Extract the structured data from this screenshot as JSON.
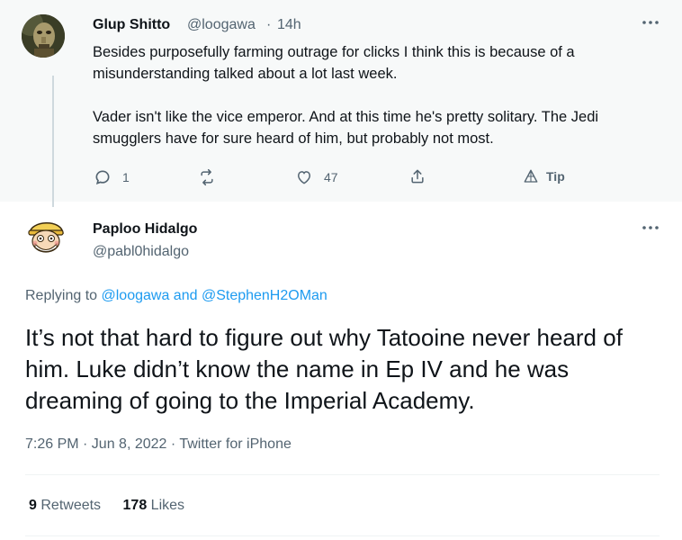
{
  "parent_tweet": {
    "author_name": "Glup Shitto",
    "author_handle": "@loogawa",
    "separator": "·",
    "time_ago": "14h",
    "more_icon": "more-icon",
    "paragraph1": "Besides purposefully farming outrage for clicks I think this is because of a misunderstanding talked about a lot last week.",
    "paragraph2": "Vader isn't like the vice emperor. And at this time he's pretty solitary. The Jedi smugglers have for sure heard of him, but probably not most.",
    "actions": {
      "reply_count": "1",
      "retweet_count": "",
      "like_count": "47",
      "tip_label": "Tip"
    }
  },
  "main_tweet": {
    "author_name": "Paploo Hidalgo",
    "author_handle": "@pabl0hidalgo",
    "replying_prefix": "Replying to",
    "replying_user1": "@loogawa",
    "replying_and": "and",
    "replying_user2": "@StephenH2OMan",
    "text": "It’s not that hard to figure out why Tatooine never heard of him. Luke didn’t know the name in Ep IV and he was dreaming of going to the Imperial Academy.",
    "timestamp": "7:26 PM · Jun 8, 2022 · Twitter for iPhone",
    "retweets_count": "9",
    "retweets_label": "Retweets",
    "likes_count": "178",
    "likes_label": "Likes"
  },
  "colors": {
    "accent": "#1d9bf0",
    "secondary_text": "#536471",
    "primary_text": "#0f1419",
    "parent_background": "#f7f9f9"
  }
}
